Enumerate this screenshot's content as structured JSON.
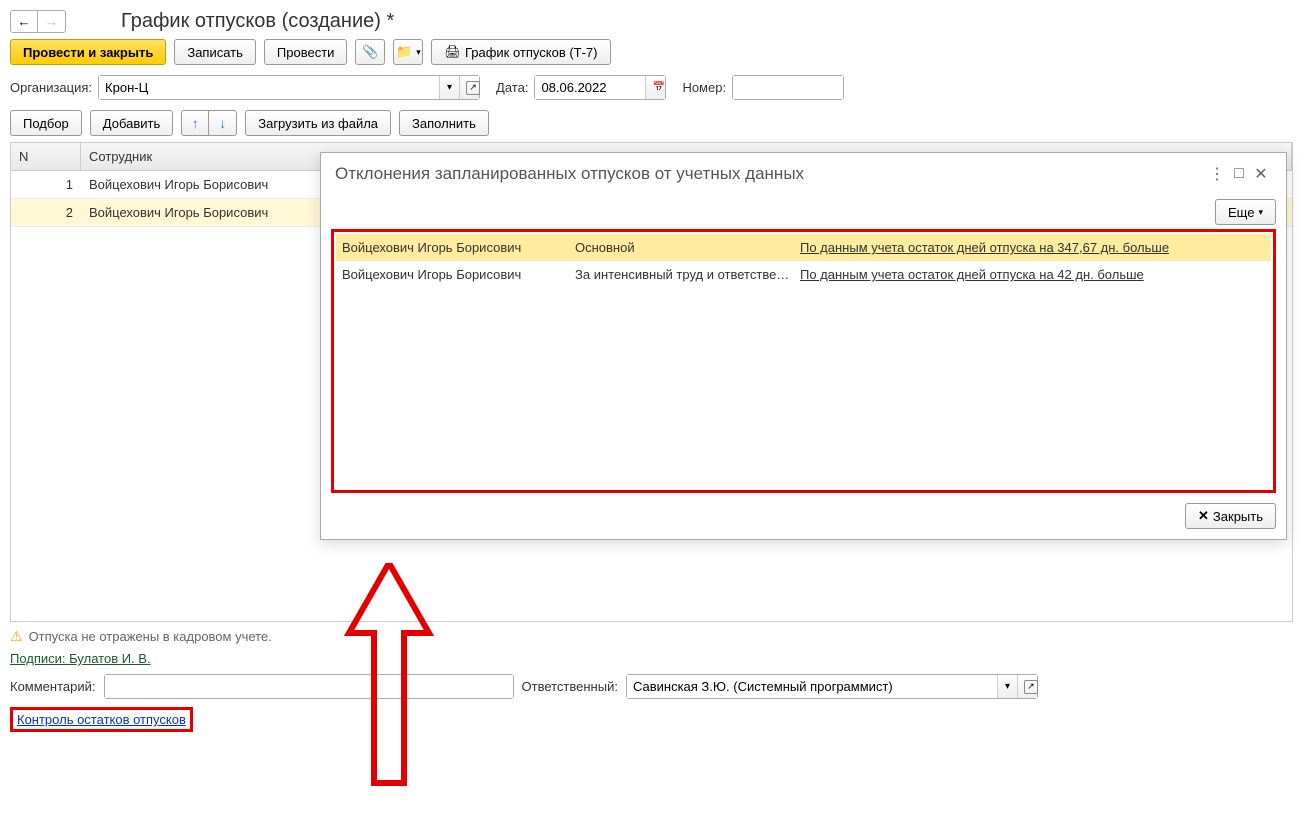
{
  "pageTitle": "График отпусков (создание) *",
  "toolbar": {
    "postClose": "Провести и закрыть",
    "save": "Записать",
    "post": "Провести",
    "print": "График отпусков (Т-7)"
  },
  "form": {
    "orgLabel": "Организация:",
    "orgValue": "Крон-Ц",
    "dateLabel": "Дата:",
    "dateValue": "08.06.2022",
    "numLabel": "Номер:",
    "numValue": ""
  },
  "toolbar2": {
    "pick": "Подбор",
    "add": "Добавить",
    "loadFile": "Загрузить из файла",
    "fill": "Заполнить"
  },
  "cols": {
    "n": "N",
    "emp": "Сотрудник"
  },
  "rows": [
    {
      "n": "1",
      "emp": "Войцехович Игорь Борисович"
    },
    {
      "n": "2",
      "emp": "Войцехович Игорь Борисович"
    }
  ],
  "warn": "Отпуска не отражены в кадровом учете.",
  "signLink": "Подписи: Булатов И. В.",
  "commentLabel": "Комментарий:",
  "commentValue": "",
  "respLabel": "Ответственный:",
  "respValue": "Савинская З.Ю. (Системный программист)",
  "controlLink": "Контроль остатков отпусков",
  "dialog": {
    "title": "Отклонения запланированных отпусков от учетных данных",
    "more": "Еще",
    "close": "Закрыть",
    "rows": [
      {
        "emp": "Войцехович Игорь Борисович",
        "type": "Основной",
        "note": "По данным учета остаток дней отпуска на 347,67 дн. больше"
      },
      {
        "emp": "Войцехович Игорь Борисович",
        "type": "За интенсивный труд и ответстве…",
        "note": "По данным учета остаток дней отпуска на 42 дн. больше"
      }
    ]
  }
}
